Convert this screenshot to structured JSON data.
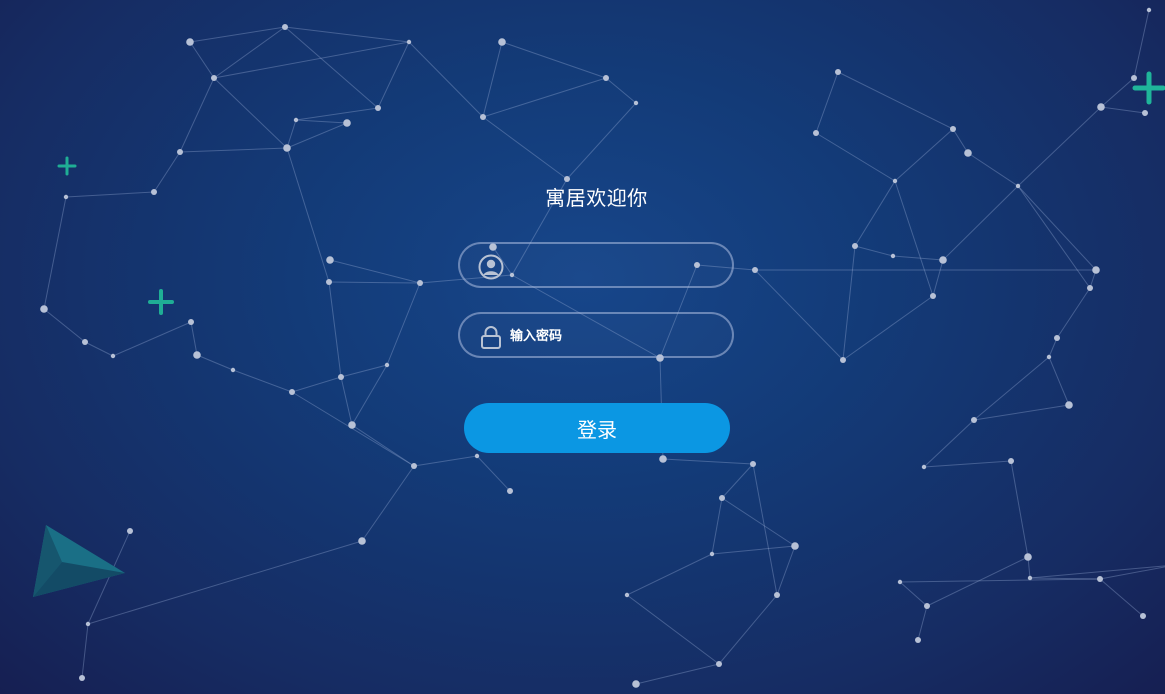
{
  "login": {
    "title": "寓居欢迎你",
    "username": {
      "value": "",
      "placeholder": ""
    },
    "password": {
      "value": "",
      "placeholder": "输入密码"
    },
    "submit_label": "登录"
  },
  "theme": {
    "background_center": "#17468a",
    "background_edge": "#161f52",
    "accent": "#0b97e3",
    "plus_color": "#1fb59a",
    "icons": [
      "user-icon",
      "lock-icon",
      "plus-icon",
      "triangle-shape"
    ]
  }
}
